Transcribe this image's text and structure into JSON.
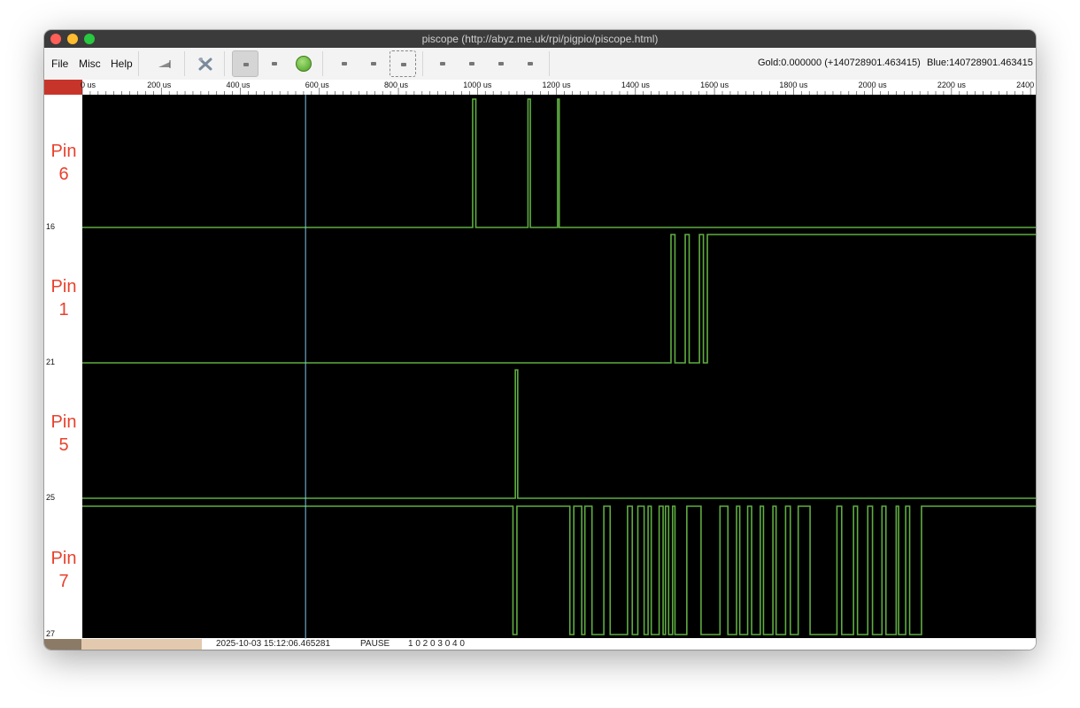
{
  "window": {
    "title": "piscope (http://abyz.me.uk/rpi/pigpio/piscope.html)"
  },
  "menu": [
    "File",
    "Misc",
    "Help"
  ],
  "toolbar": {
    "buttons": [
      {
        "name": "trigger-icon-button"
      },
      {
        "name": "tools-icon-button"
      },
      {
        "name": "live-mode-button",
        "active": true
      },
      {
        "name": "play-mode-button"
      },
      {
        "name": "run-status-led"
      },
      {
        "name": "zoom-in-button"
      },
      {
        "name": "zoom-out-button"
      },
      {
        "name": "zoom-fit-button"
      },
      {
        "name": "trigger-1-button"
      },
      {
        "name": "trigger-2-button"
      },
      {
        "name": "trigger-3-button"
      },
      {
        "name": "trigger-4-button"
      }
    ],
    "gold_readout": "Gold:0.000000 (+140728901.463415)",
    "blue_readout": "Blue:140728901.463415"
  },
  "ruler": {
    "labels": [
      "0 us",
      "200 us",
      "400 us",
      "600 us",
      "800 us",
      "1000 us",
      "1200 us",
      "1400 us",
      "1600 us",
      "1800 us",
      "2000 us",
      "2200 us",
      "2400"
    ]
  },
  "cursor": {
    "blue_time_us": 565
  },
  "traces": [
    {
      "label_line1": "Pin",
      "label_line2": "6",
      "gpio": "16",
      "transitions_us": [
        988,
        996,
        1128,
        1134,
        1203,
        1207
      ],
      "initial": 0
    },
    {
      "label_line1": "Pin",
      "label_line2": "1",
      "gpio": "21",
      "transitions_us": [
        1490,
        1500,
        1526,
        1536,
        1562,
        1572,
        1582
      ],
      "initial": 0
    },
    {
      "label_line1": "Pin",
      "label_line2": "5",
      "gpio": "25",
      "transitions_us": [
        1096,
        1102
      ],
      "initial": 0
    },
    {
      "label_line1": "Pin",
      "label_line2": "7",
      "gpio": "27",
      "transitions_us": [
        1090,
        1100,
        1234,
        1244,
        1264,
        1272,
        1290,
        1320,
        1336,
        1380,
        1392,
        1406,
        1422,
        1432,
        1440,
        1460,
        1470,
        1476,
        1484,
        1494,
        1500,
        1530,
        1566,
        1614,
        1634,
        1656,
        1664,
        1684,
        1694,
        1716,
        1724,
        1748,
        1756,
        1780,
        1792,
        1812,
        1842,
        1910,
        1922,
        1952,
        1962,
        1988,
        2000,
        2024,
        2034,
        2060,
        2066,
        2084,
        2094,
        2124
      ],
      "initial": 1
    }
  ],
  "status": {
    "timestamp": "2025-10-03 15:12:06.465281",
    "mode": "PAUSE",
    "counters": "1 0  2 0  3 0  4 0"
  },
  "colors": {
    "trace": "#5fad41",
    "cursor": "#7ec8e3",
    "pin_label": "#e8412d"
  }
}
